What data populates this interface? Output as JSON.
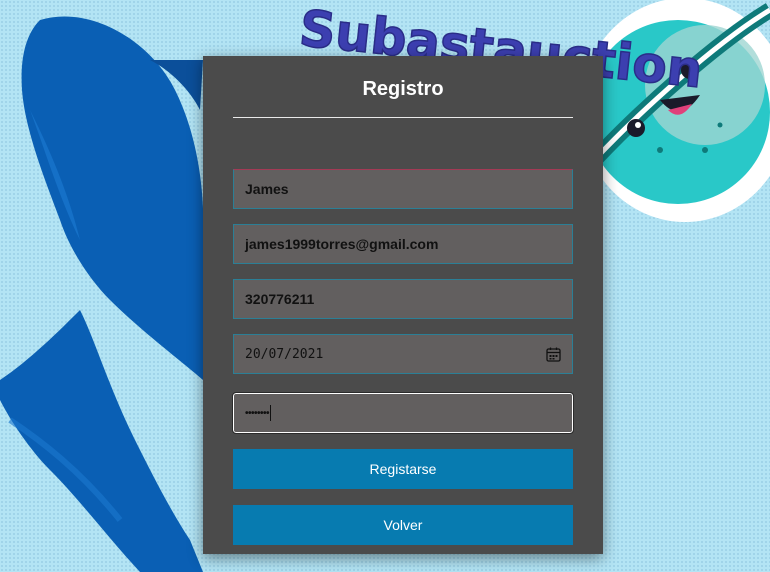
{
  "background": {
    "logo_text": "Subastauction",
    "colors": {
      "page": "#b3e4f4",
      "brush": "#0a5fb4",
      "planet": "#29c8c8",
      "logo_text": "#4a4ec8"
    }
  },
  "form": {
    "title": "Registro",
    "fields": {
      "name": {
        "value": "James"
      },
      "email": {
        "value": "james1999torres@gmail.com"
      },
      "phone": {
        "value": "320776211"
      },
      "birthdate": {
        "value": "20/07/2021",
        "icon": "calendar-icon"
      },
      "password": {
        "value": "••••••••"
      }
    },
    "buttons": {
      "register_label": "Registarse",
      "back_label": "Volver"
    },
    "colors": {
      "card": "#4b4b4b",
      "field": "#625f5f",
      "field_border": "#2b7f96",
      "button": "#077bb0"
    }
  }
}
